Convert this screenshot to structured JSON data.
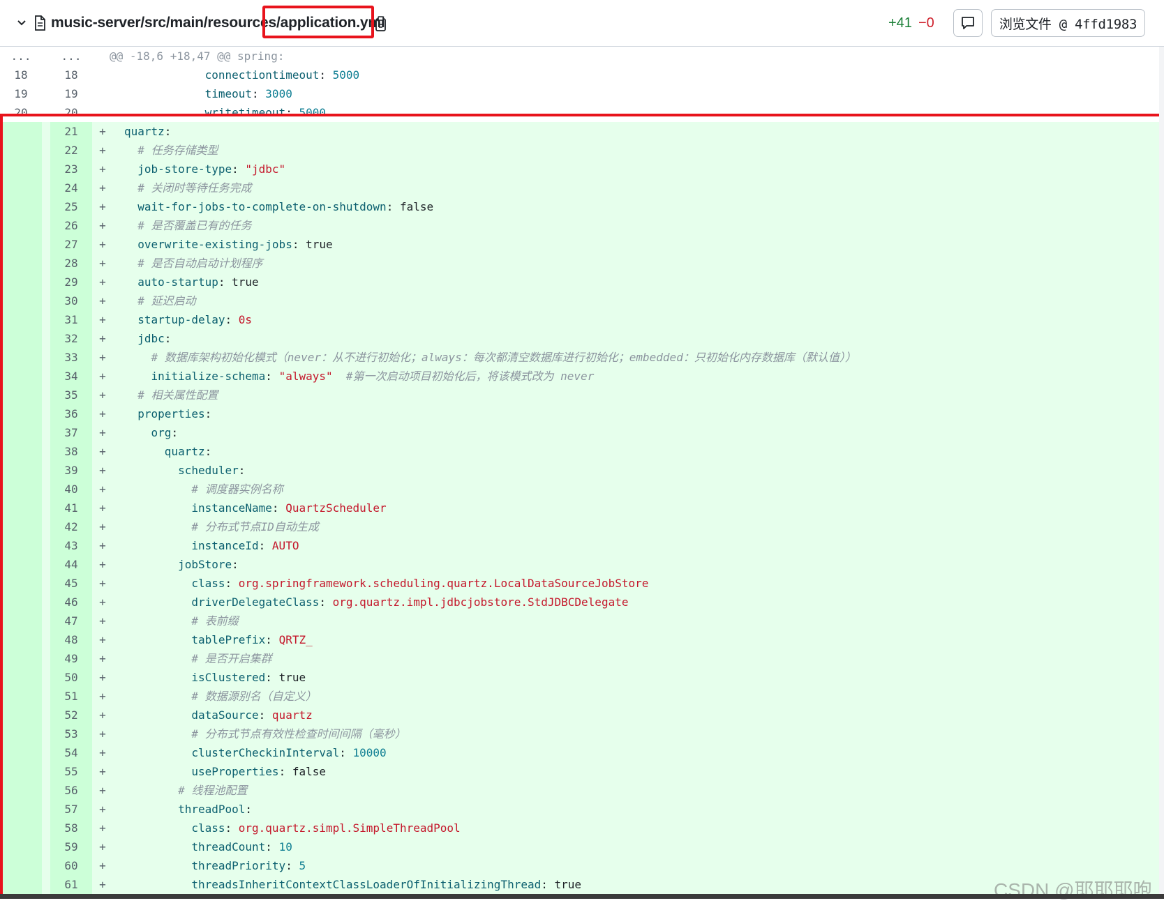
{
  "header": {
    "file_path_prefix": "music-server/src/main/resources/",
    "file_name": "application.yml",
    "additions": "+41",
    "deletions": "−0",
    "view_file_button": "浏览文件 @ 4ffd1983"
  },
  "diff": {
    "ellipsis_old": "...",
    "ellipsis_new": "...",
    "hunk_header": "@@ -18,6 +18,47 @@ spring:",
    "context_lines": [
      {
        "old": "18",
        "new": "18",
        "indent": "            ",
        "key": "connectiontimeout",
        "sep": ": ",
        "value": "5000",
        "vtype": "num"
      },
      {
        "old": "19",
        "new": "19",
        "indent": "            ",
        "key": "timeout",
        "sep": ": ",
        "value": "3000",
        "vtype": "num"
      },
      {
        "old": "20",
        "new": "20",
        "indent": "            ",
        "key": "writetimeout",
        "sep": ": ",
        "value": "5000",
        "vtype": "num"
      }
    ],
    "added_lines": [
      {
        "new": "21",
        "indent": "",
        "key": "quartz",
        "sep": ":",
        "value": "",
        "vtype": ""
      },
      {
        "new": "22",
        "indent": "  ",
        "comment": "# 任务存储类型"
      },
      {
        "new": "23",
        "indent": "  ",
        "key": "job-store-type",
        "sep": ": ",
        "value": "\"jdbc\"",
        "vtype": "s"
      },
      {
        "new": "24",
        "indent": "  ",
        "comment": "# 关闭时等待任务完成"
      },
      {
        "new": "25",
        "indent": "  ",
        "key": "wait-for-jobs-to-complete-on-shutdown",
        "sep": ": ",
        "value": "false",
        "vtype": "b"
      },
      {
        "new": "26",
        "indent": "  ",
        "comment": "# 是否覆盖已有的任务"
      },
      {
        "new": "27",
        "indent": "  ",
        "key": "overwrite-existing-jobs",
        "sep": ": ",
        "value": "true",
        "vtype": "b"
      },
      {
        "new": "28",
        "indent": "  ",
        "comment": "# 是否自动启动计划程序"
      },
      {
        "new": "29",
        "indent": "  ",
        "key": "auto-startup",
        "sep": ": ",
        "value": "true",
        "vtype": "b"
      },
      {
        "new": "30",
        "indent": "  ",
        "comment": "# 延迟启动"
      },
      {
        "new": "31",
        "indent": "  ",
        "key": "startup-delay",
        "sep": ": ",
        "value": "0s",
        "vtype": "s"
      },
      {
        "new": "32",
        "indent": "  ",
        "key": "jdbc",
        "sep": ":",
        "value": "",
        "vtype": ""
      },
      {
        "new": "33",
        "indent": "    ",
        "comment": "# 数据库架构初始化模式（never：从不进行初始化；always：每次都清空数据库进行初始化；embedded：只初始化内存数据库（默认值））"
      },
      {
        "new": "34",
        "indent": "    ",
        "key": "initialize-schema",
        "sep": ": ",
        "value": "\"always\"",
        "vtype": "s",
        "trail": "  #第一次启动项目初始化后，将该模式改为 never"
      },
      {
        "new": "35",
        "indent": "  ",
        "comment": "# 相关属性配置"
      },
      {
        "new": "36",
        "indent": "  ",
        "key": "properties",
        "sep": ":",
        "value": "",
        "vtype": ""
      },
      {
        "new": "37",
        "indent": "    ",
        "key": "org",
        "sep": ":",
        "value": "",
        "vtype": ""
      },
      {
        "new": "38",
        "indent": "      ",
        "key": "quartz",
        "sep": ":",
        "value": "",
        "vtype": ""
      },
      {
        "new": "39",
        "indent": "        ",
        "key": "scheduler",
        "sep": ":",
        "value": "",
        "vtype": ""
      },
      {
        "new": "40",
        "indent": "          ",
        "comment": "# 调度器实例名称"
      },
      {
        "new": "41",
        "indent": "          ",
        "key": "instanceName",
        "sep": ": ",
        "value": "QuartzScheduler",
        "vtype": "s"
      },
      {
        "new": "42",
        "indent": "          ",
        "comment": "# 分布式节点ID自动生成"
      },
      {
        "new": "43",
        "indent": "          ",
        "key": "instanceId",
        "sep": ": ",
        "value": "AUTO",
        "vtype": "s"
      },
      {
        "new": "44",
        "indent": "        ",
        "key": "jobStore",
        "sep": ":",
        "value": "",
        "vtype": ""
      },
      {
        "new": "45",
        "indent": "          ",
        "key": "class",
        "sep": ": ",
        "value": "org.springframework.scheduling.quartz.LocalDataSourceJobStore",
        "vtype": "s"
      },
      {
        "new": "46",
        "indent": "          ",
        "key": "driverDelegateClass",
        "sep": ": ",
        "value": "org.quartz.impl.jdbcjobstore.StdJDBCDelegate",
        "vtype": "s"
      },
      {
        "new": "47",
        "indent": "          ",
        "comment": "# 表前缀"
      },
      {
        "new": "48",
        "indent": "          ",
        "key": "tablePrefix",
        "sep": ": ",
        "value": "QRTZ_",
        "vtype": "s"
      },
      {
        "new": "49",
        "indent": "          ",
        "comment": "# 是否开启集群"
      },
      {
        "new": "50",
        "indent": "          ",
        "key": "isClustered",
        "sep": ": ",
        "value": "true",
        "vtype": "b"
      },
      {
        "new": "51",
        "indent": "          ",
        "comment": "# 数据源别名（自定义）"
      },
      {
        "new": "52",
        "indent": "          ",
        "key": "dataSource",
        "sep": ": ",
        "value": "quartz",
        "vtype": "s"
      },
      {
        "new": "53",
        "indent": "          ",
        "comment": "# 分布式节点有效性检查时间间隔（毫秒）"
      },
      {
        "new": "54",
        "indent": "          ",
        "key": "clusterCheckinInterval",
        "sep": ": ",
        "value": "10000",
        "vtype": "num"
      },
      {
        "new": "55",
        "indent": "          ",
        "key": "useProperties",
        "sep": ": ",
        "value": "false",
        "vtype": "b"
      },
      {
        "new": "56",
        "indent": "        ",
        "comment": "# 线程池配置"
      },
      {
        "new": "57",
        "indent": "        ",
        "key": "threadPool",
        "sep": ":",
        "value": "",
        "vtype": ""
      },
      {
        "new": "58",
        "indent": "          ",
        "key": "class",
        "sep": ": ",
        "value": "org.quartz.simpl.SimpleThreadPool",
        "vtype": "s"
      },
      {
        "new": "59",
        "indent": "          ",
        "key": "threadCount",
        "sep": ": ",
        "value": "10",
        "vtype": "num"
      },
      {
        "new": "60",
        "indent": "          ",
        "key": "threadPriority",
        "sep": ": ",
        "value": "5",
        "vtype": "num"
      },
      {
        "new": "61",
        "indent": "          ",
        "key": "threadsInheritContextClassLoaderOfInitializingThread",
        "sep": ": ",
        "value": "true",
        "vtype": "b"
      }
    ],
    "add_sign": "+"
  },
  "watermark": "CSDN @耶耶耶咆",
  "colors": {
    "add_bg": "#e6ffec",
    "add_gutter_bg": "#ccffd8",
    "highlight_box": "#e8131c",
    "key": "#0b5f6f",
    "string": "#c4162a",
    "number": "#0d7d92"
  }
}
